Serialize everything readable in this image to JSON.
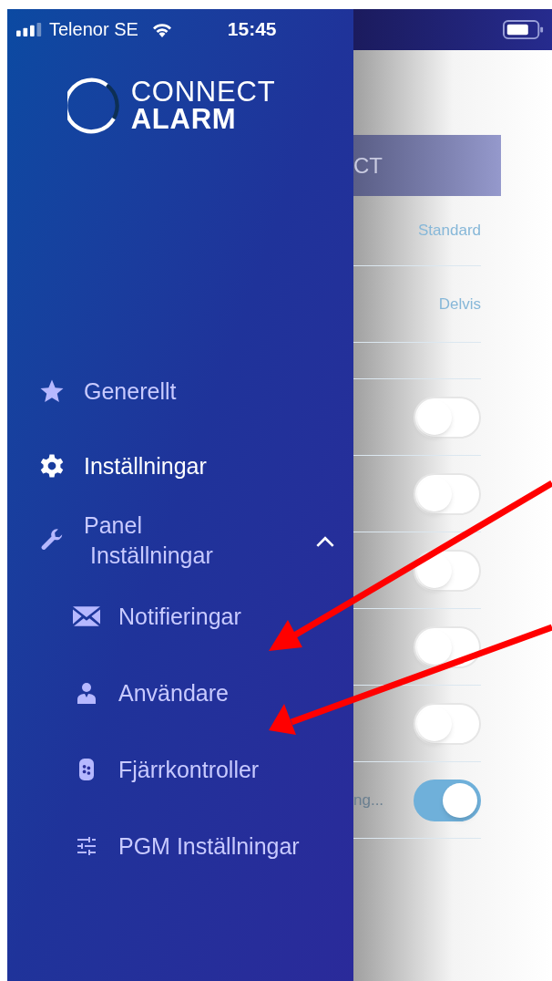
{
  "status_bar": {
    "carrier": "Telenor SE",
    "time": "15:45"
  },
  "logo": {
    "line1": "CONNECT",
    "line2": "ALARM"
  },
  "menu": [
    {
      "label": "Generellt"
    },
    {
      "label": "Inställningar"
    },
    {
      "label": "Panel\n Inställningar",
      "expanded": true,
      "children": [
        {
          "label": "Notifieringar"
        },
        {
          "label": "Användare"
        },
        {
          "label": "Fjärrkontroller"
        },
        {
          "label": "PGM Inställningar"
        }
      ]
    }
  ],
  "background_page": {
    "banner": "CT",
    "rows": [
      {
        "kind": "value",
        "value": "Standard"
      },
      {
        "kind": "value",
        "value": "Delvis"
      },
      {
        "kind": "blank"
      },
      {
        "kind": "toggle",
        "on": false
      },
      {
        "kind": "toggle",
        "on": false
      },
      {
        "kind": "toggle",
        "on": false
      },
      {
        "kind": "toggle",
        "on": false
      },
      {
        "kind": "toggle",
        "on": false
      },
      {
        "kind": "toggle",
        "label": "ng...",
        "on": true
      }
    ]
  }
}
